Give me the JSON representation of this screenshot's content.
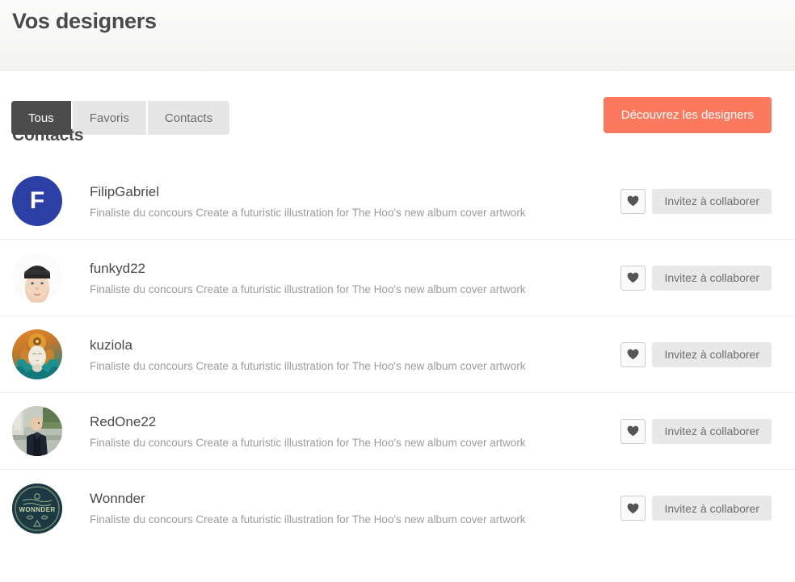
{
  "header": {
    "title": "Vos designers"
  },
  "toolbar": {
    "tabs": [
      {
        "label": "Tous",
        "active": true
      },
      {
        "label": "Favoris",
        "active": false
      },
      {
        "label": "Contacts",
        "active": false
      }
    ],
    "discover_label": "Découvrez les designers",
    "accent_color": "#fb7a5f",
    "active_tab_color": "#4c4c4c",
    "inactive_tab_color": "#e6e6e6"
  },
  "main": {
    "section_title": "Contacts",
    "favorite_icon": "heart-icon",
    "invite_label": "Invitez à collaborer",
    "contacts": [
      {
        "name": "FilipGabriel",
        "description": "Finaliste du concours Create a futuristic illustration for The Hoo's new album cover artwork",
        "avatar_type": "initial",
        "avatar_initial": "F",
        "avatar_color": "#2c3fa5"
      },
      {
        "name": "funkyd22",
        "description": "Finaliste du concours Create a futuristic illustration for The Hoo's new album cover artwork",
        "avatar_type": "photo-man-beanie",
        "avatar_initial": "",
        "avatar_color": "#f2e3d8"
      },
      {
        "name": "kuziola",
        "description": "Finaliste du concours Create a futuristic illustration for The Hoo's new album cover artwork",
        "avatar_type": "illustration-ornate-head",
        "avatar_initial": "",
        "avatar_color": "#d1802f"
      },
      {
        "name": "RedOne22",
        "description": "Finaliste du concours Create a futuristic illustration for The Hoo's new album cover artwork",
        "avatar_type": "photo-man-outdoors",
        "avatar_initial": "",
        "avatar_color": "#6d7a6a"
      },
      {
        "name": "Wonnder",
        "description": "Finaliste du concours Create a futuristic illustration for The Hoo's new album cover artwork",
        "avatar_type": "logo-wonnder",
        "avatar_initial": "",
        "avatar_color": "#1d3a44"
      }
    ]
  }
}
